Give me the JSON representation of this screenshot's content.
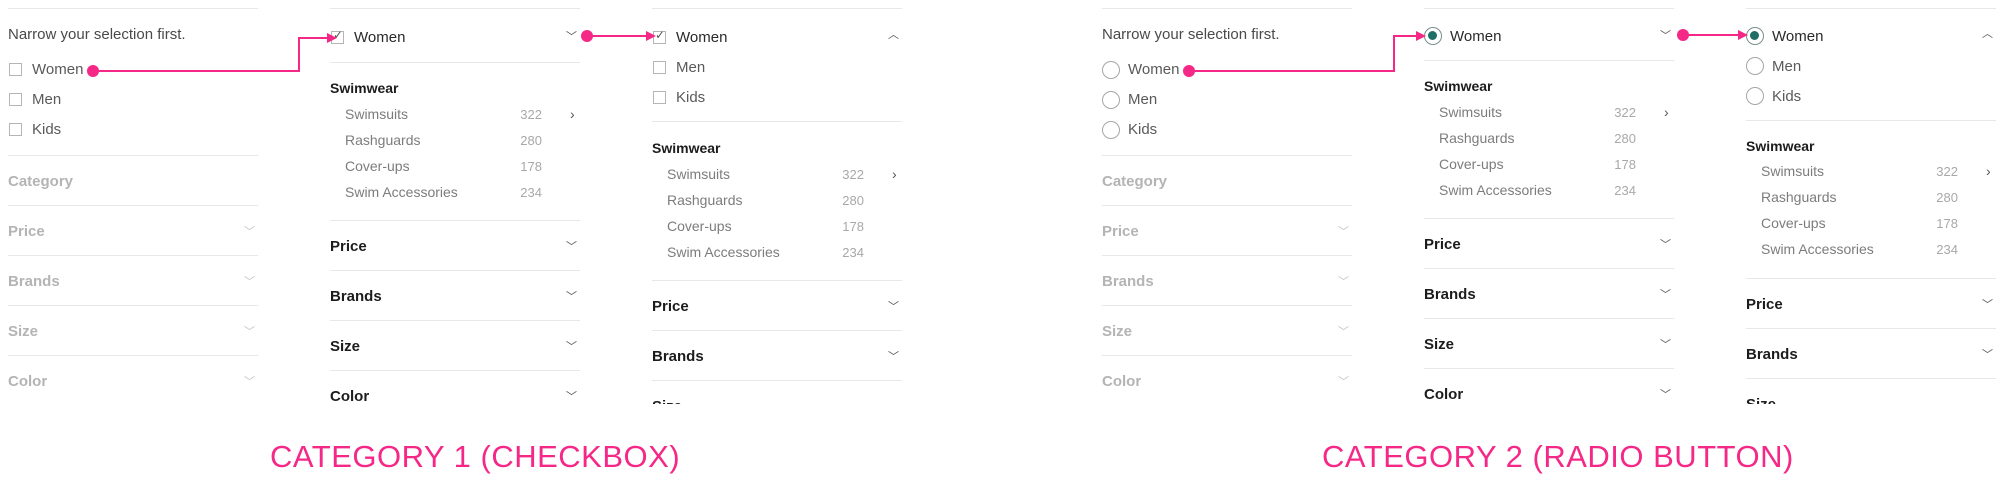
{
  "prompt": "Narrow your selection first.",
  "options": [
    "Women",
    "Men",
    "Kids"
  ],
  "selected_option": "Women",
  "group": {
    "title": "Swimwear",
    "items": [
      {
        "label": "Swimsuits",
        "count": "322"
      },
      {
        "label": "Rashguards",
        "count": "280"
      },
      {
        "label": "Cover-ups",
        "count": "178"
      },
      {
        "label": "Swim Accessories",
        "count": "234"
      }
    ]
  },
  "filters": {
    "category": "Category",
    "price": "Price",
    "brands": "Brands",
    "size": "Size",
    "color": "Color"
  },
  "captions": {
    "left": "CATEGORY 1 (CHECKBOX)",
    "right": "CATEGORY 2 (RADIO BUTTON)"
  },
  "colors": {
    "accent": "#f52787",
    "radio_selected": "#1f6e68"
  }
}
